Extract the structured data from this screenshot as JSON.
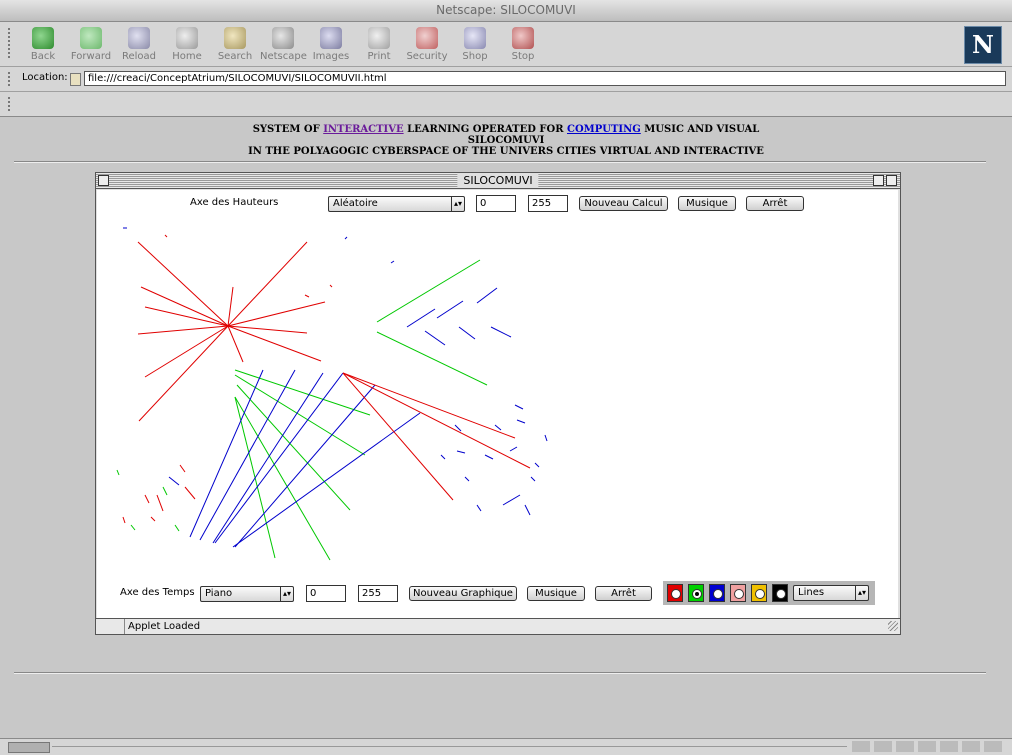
{
  "window": {
    "title": "Netscape: SILOCOMUVI"
  },
  "toolbar": {
    "buttons": [
      {
        "label": "Back",
        "icon": "back-arrow-icon"
      },
      {
        "label": "Forward",
        "icon": "forward-arrow-icon"
      },
      {
        "label": "Reload",
        "icon": "reload-icon"
      },
      {
        "label": "Home",
        "icon": "home-icon"
      },
      {
        "label": "Search",
        "icon": "search-icon"
      },
      {
        "label": "Netscape",
        "icon": "netscape-icon"
      },
      {
        "label": "Images",
        "icon": "images-icon"
      },
      {
        "label": "Print",
        "icon": "print-icon"
      },
      {
        "label": "Security",
        "icon": "security-lock-icon"
      },
      {
        "label": "Shop",
        "icon": "shop-icon"
      },
      {
        "label": "Stop",
        "icon": "stop-icon"
      }
    ],
    "logo": "N"
  },
  "location": {
    "label": "Location:",
    "url": "file:///creaci/ConceptAtrium/SILOCOMUVI/SILOCOMUVII.html"
  },
  "page": {
    "heading": {
      "l1_pre": "SYSTEM OF ",
      "l1_link1": "INTERACTIVE",
      "l1_mid": " LEARNING OPERATED FOR ",
      "l1_link2": "COMPUTING",
      "l1_post": " MUSIC AND VISUAL",
      "l2": "SILOCOMUVI",
      "l3": "IN THE POLYAGOGIC CYBERSPACE OF THE UNIVERS CITIES VIRTUAL AND INTERACTIVE"
    }
  },
  "applet": {
    "title": "SILOCOMUVI",
    "top": {
      "label": "Axe des Hauteurs",
      "select": "Aléatoire",
      "min": "0",
      "max": "255",
      "calc_button": "Nouveau Calcul",
      "music_button": "Musique",
      "stop_button": "Arrêt"
    },
    "bottom": {
      "label": "Axe des Temps",
      "select": "Piano",
      "min": "0",
      "max": "255",
      "graph_button": "Nouveau Graphique",
      "music_button": "Musique",
      "stop_button": "Arrêt",
      "colors": [
        {
          "name": "red",
          "hex": "#e00000",
          "selected": false
        },
        {
          "name": "green",
          "hex": "#00d000",
          "selected": true
        },
        {
          "name": "blue",
          "hex": "#0000d0",
          "selected": false
        },
        {
          "name": "pink",
          "hex": "#f0a0a0",
          "selected": false
        },
        {
          "name": "yellow",
          "hex": "#f0c000",
          "selected": false
        },
        {
          "name": "black",
          "hex": "#000000",
          "selected": false
        }
      ],
      "mode_select": "Lines"
    },
    "status": "Applet Loaded"
  }
}
